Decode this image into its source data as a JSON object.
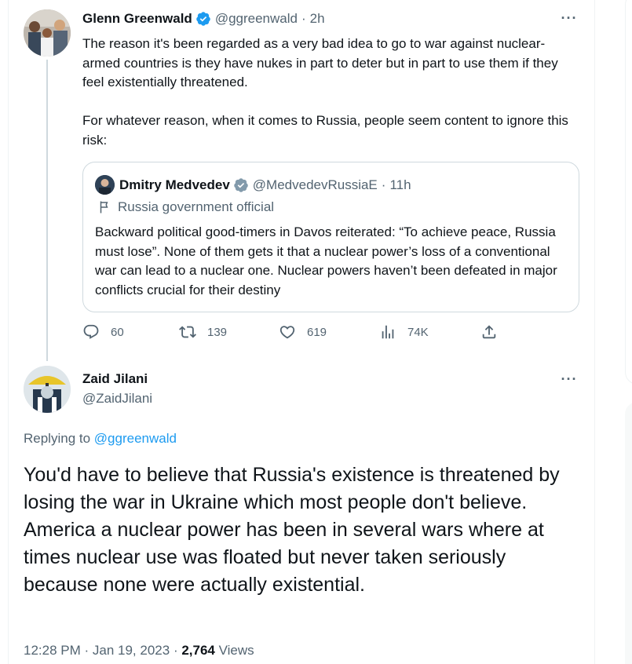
{
  "tweet": {
    "author_name": "Glenn Greenwald",
    "author_handle": "@ggreenwald",
    "time": "2h",
    "paragraphs": [
      "The reason it's been regarded as a very bad idea to go to war against nuclear-armed countries is they have nukes in part to deter but in part to use them if they feel existentially threatened.",
      "For whatever reason, when it comes to Russia, people seem content to ignore this risk:"
    ],
    "quote": {
      "author_name": "Dmitry Medvedev",
      "author_handle": "@MedvedevRussiaE",
      "time": "11h",
      "label": "Russia government official",
      "text": "Backward political good-timers in Davos reiterated: “To achieve peace, Russia must lose”. None of them gets it that a nuclear power’s loss of a conventional war can lead to a nuclear one. Nuclear powers haven’t been defeated in major conflicts crucial for their destiny"
    },
    "actions": {
      "replies": "60",
      "retweets": "139",
      "likes": "619",
      "views": "74K"
    }
  },
  "reply": {
    "author_name": "Zaid Jilani",
    "author_handle": "@ZaidJilani",
    "replying_prefix": "Replying to",
    "replying_to": "@ggreenwald",
    "text": "You'd have to believe that Russia's existence is threatened by losing the war in Ukraine which most people don't believe. America a nuclear power has been in several wars where at times nuclear use was floated but never taken seriously because none were actually existential.",
    "time": "12:28 PM",
    "date": "Jan 19, 2023",
    "views_count": "2,764",
    "views_label": "Views"
  },
  "colors": {
    "accent": "#1d9bf0",
    "text": "#0f1419",
    "secondary": "#536471",
    "border": "#cfd9de",
    "verified_gold": "#829aab"
  },
  "icons": [
    "verified-badge-icon",
    "more-icon",
    "flag-icon",
    "reply-icon",
    "retweet-icon",
    "like-icon",
    "views-icon",
    "share-icon"
  ]
}
